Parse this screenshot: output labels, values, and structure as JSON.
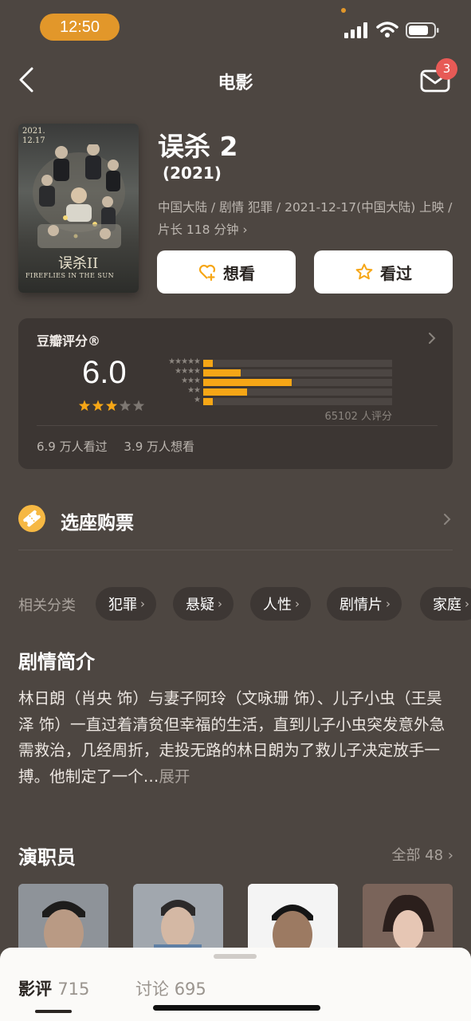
{
  "status_bar": {
    "time": "12:50"
  },
  "nav": {
    "title": "电影",
    "mail_badge": "3"
  },
  "poster": {
    "date_line1": "2021.",
    "date_line2": "12.17",
    "title_art": "误杀II",
    "subtitle_art": "FIREFLIES IN THE SUN"
  },
  "movie": {
    "title": "误杀 2",
    "year": "(2021)",
    "meta": "中国大陆 / 剧情 犯罪 / 2021-12-17(中国大陆) 上映 / 片长 118 分钟 ›"
  },
  "actions": {
    "want": "想看",
    "seen": "看过"
  },
  "rating": {
    "label": "豆瓣评分®",
    "score": "6.0",
    "stars_filled": 3,
    "distribution": [
      {
        "stars": "★★★★★",
        "fraction": 0.05
      },
      {
        "stars": "★★★★",
        "fraction": 0.2
      },
      {
        "stars": "★★★",
        "fraction": 0.47
      },
      {
        "stars": "★★",
        "fraction": 0.23
      },
      {
        "stars": "★",
        "fraction": 0.05
      }
    ],
    "count": "65102 人评分",
    "seen": "6.9 万人看过",
    "wanted": "3.9 万人想看"
  },
  "ticket": {
    "label": "选座购票"
  },
  "tags": {
    "label": "相关分类",
    "items": [
      "犯罪",
      "悬疑",
      "人性",
      "剧情片",
      "家庭"
    ]
  },
  "synopsis": {
    "title": "剧情简介",
    "text": "林日朗（肖央 饰）与妻子阿玲（文咏珊 饰）、儿子小虫（王昊泽 饰）一直过着清贫但幸福的生活，直到儿子小虫突发意外急需救治，几经周折，走投无路的林日朗为了救儿子决定放手一搏。他制定了一个…",
    "expand": "展开"
  },
  "cast": {
    "title": "演职员",
    "all": "全部 48 ›"
  },
  "bottom_tabs": {
    "reviews_label": "影评",
    "reviews_count": "715",
    "discussion_label": "讨论",
    "discussion_count": "695"
  },
  "colors": {
    "accent": "#f6a616",
    "background": "#4d4641",
    "card": "#3c3633",
    "badge": "#e75a56"
  }
}
